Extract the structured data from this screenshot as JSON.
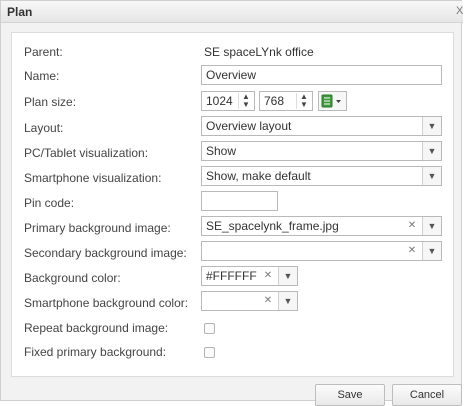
{
  "dialog": {
    "title": "Plan",
    "close_glyph": "X"
  },
  "form": {
    "parent": {
      "label": "Parent:",
      "value": "SE spaceLYnk office"
    },
    "name": {
      "label": "Name:",
      "value": "Overview"
    },
    "plan_size": {
      "label": "Plan size:",
      "width": "1024",
      "height": "768",
      "icon": "resize-icon"
    },
    "layout": {
      "label": "Layout:",
      "value": "Overview layout"
    },
    "pc_tablet": {
      "label": "PC/Tablet visualization:",
      "value": "Show"
    },
    "smartphone": {
      "label": "Smartphone visualization:",
      "value": "Show, make default"
    },
    "pin_code": {
      "label": "Pin code:",
      "value": ""
    },
    "primary_bg": {
      "label": "Primary background image:",
      "value": "SE_spacelynk_frame.jpg"
    },
    "secondary_bg": {
      "label": "Secondary background image:",
      "value": ""
    },
    "bg_color": {
      "label": "Background color:",
      "value": "#FFFFFF"
    },
    "smartphone_bg_color": {
      "label": "Smartphone background color:",
      "value": ""
    },
    "repeat_bg": {
      "label": "Repeat background image:",
      "checked": false
    },
    "fixed_primary_bg": {
      "label": "Fixed primary background:",
      "checked": false
    }
  },
  "buttons": {
    "save": "Save",
    "cancel": "Cancel"
  },
  "colors": {
    "accent_green": "#3c9a3c",
    "dialog_bg": "#f2f2f2"
  }
}
